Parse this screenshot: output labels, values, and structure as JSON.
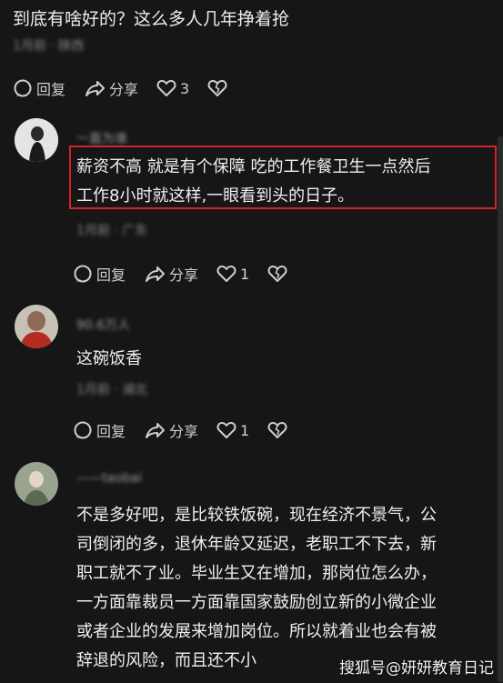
{
  "top_comment": {
    "text": "到底有啥好的？这么多人几年挣着抢",
    "meta": "1月前 · 陕西",
    "actions": {
      "reply": "回复",
      "share": "分享",
      "likes": "3"
    }
  },
  "replies": [
    {
      "username": "一直为谁",
      "text_lines": [
        "薪资不高 就是有个保障 吃的工作餐卫生一点然后",
        "工作8小时就这样,一眼看到头的日子。"
      ],
      "meta": "1月前 · 广东",
      "actions": {
        "reply": "回复",
        "share": "分享",
        "likes": "1"
      }
    },
    {
      "username": "90.6万人",
      "text_lines": [
        "这碗饭香"
      ],
      "meta": "1月前 · 湖北",
      "actions": {
        "reply": "回复",
        "share": "分享",
        "likes": "1"
      }
    },
    {
      "username": "——taobai",
      "text_lines": [
        "不是多好吧，是比较铁饭碗，现在经济不景气，公",
        "司倒闭的多，退休年龄又延迟，老职工不下去，新",
        "职工就不了业。毕业生又在增加，那岗位怎么办，",
        "一方面靠裁员一方面靠国家鼓励创立新的小微企业",
        "或者企业的发展来增加岗位。所以就着业也会有被",
        "辞退的风险，而且还不小"
      ]
    }
  ],
  "watermark": "搜狐号@妍妍教育日记",
  "colors": {
    "highlight_border": "#d2222b",
    "background": "#161616"
  }
}
